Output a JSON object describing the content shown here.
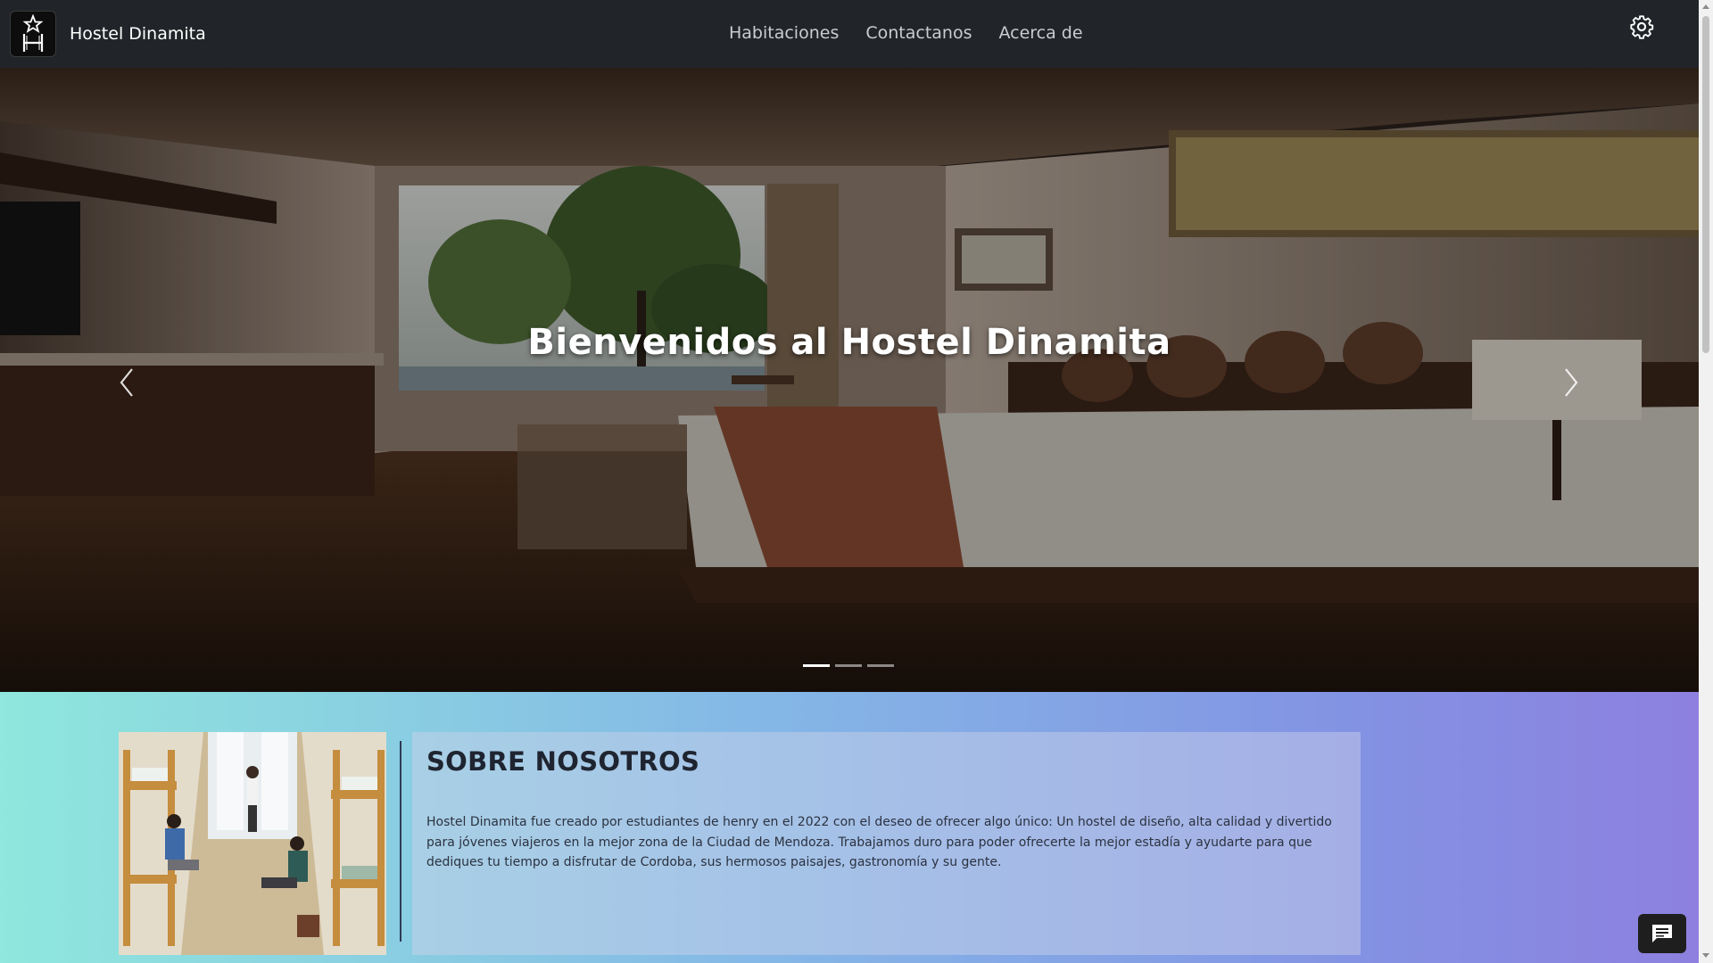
{
  "navbar": {
    "brand_name": "Hostel Dinamita",
    "logo_icon": "hostel-star-h-logo",
    "links": [
      "Habitaciones",
      "Contactanos",
      "Acerca de"
    ],
    "settings_icon": "gear-icon"
  },
  "hero": {
    "caption": "Bienvenidos al Hostel Dinamita",
    "prev_icon": "chevron-left-icon",
    "next_icon": "chevron-right-icon",
    "slides_count": 3,
    "active_slide": 1
  },
  "about": {
    "title": "SOBRE NOSOTROS",
    "text": "Hostel Dinamita fue creado por estudiantes de henry en el 2022 con el deseo de ofrecer algo único: Un hostel de diseño, alta calidad y divertido para jóvenes viajeros en la mejor zona de la Ciudad de Mendoza. Trabajamos duro para poder ofrecerte la mejor estadía y ayudarte para que dediques tu tiempo a disfrutar de Cordoba, sus hermosos paisajes, gastronomía y su gente."
  },
  "chat": {
    "icon": "chat-icon"
  },
  "colors": {
    "navbar_bg": "#212529",
    "gradient_start": "#8fe7dd",
    "gradient_end": "#8d80df"
  }
}
